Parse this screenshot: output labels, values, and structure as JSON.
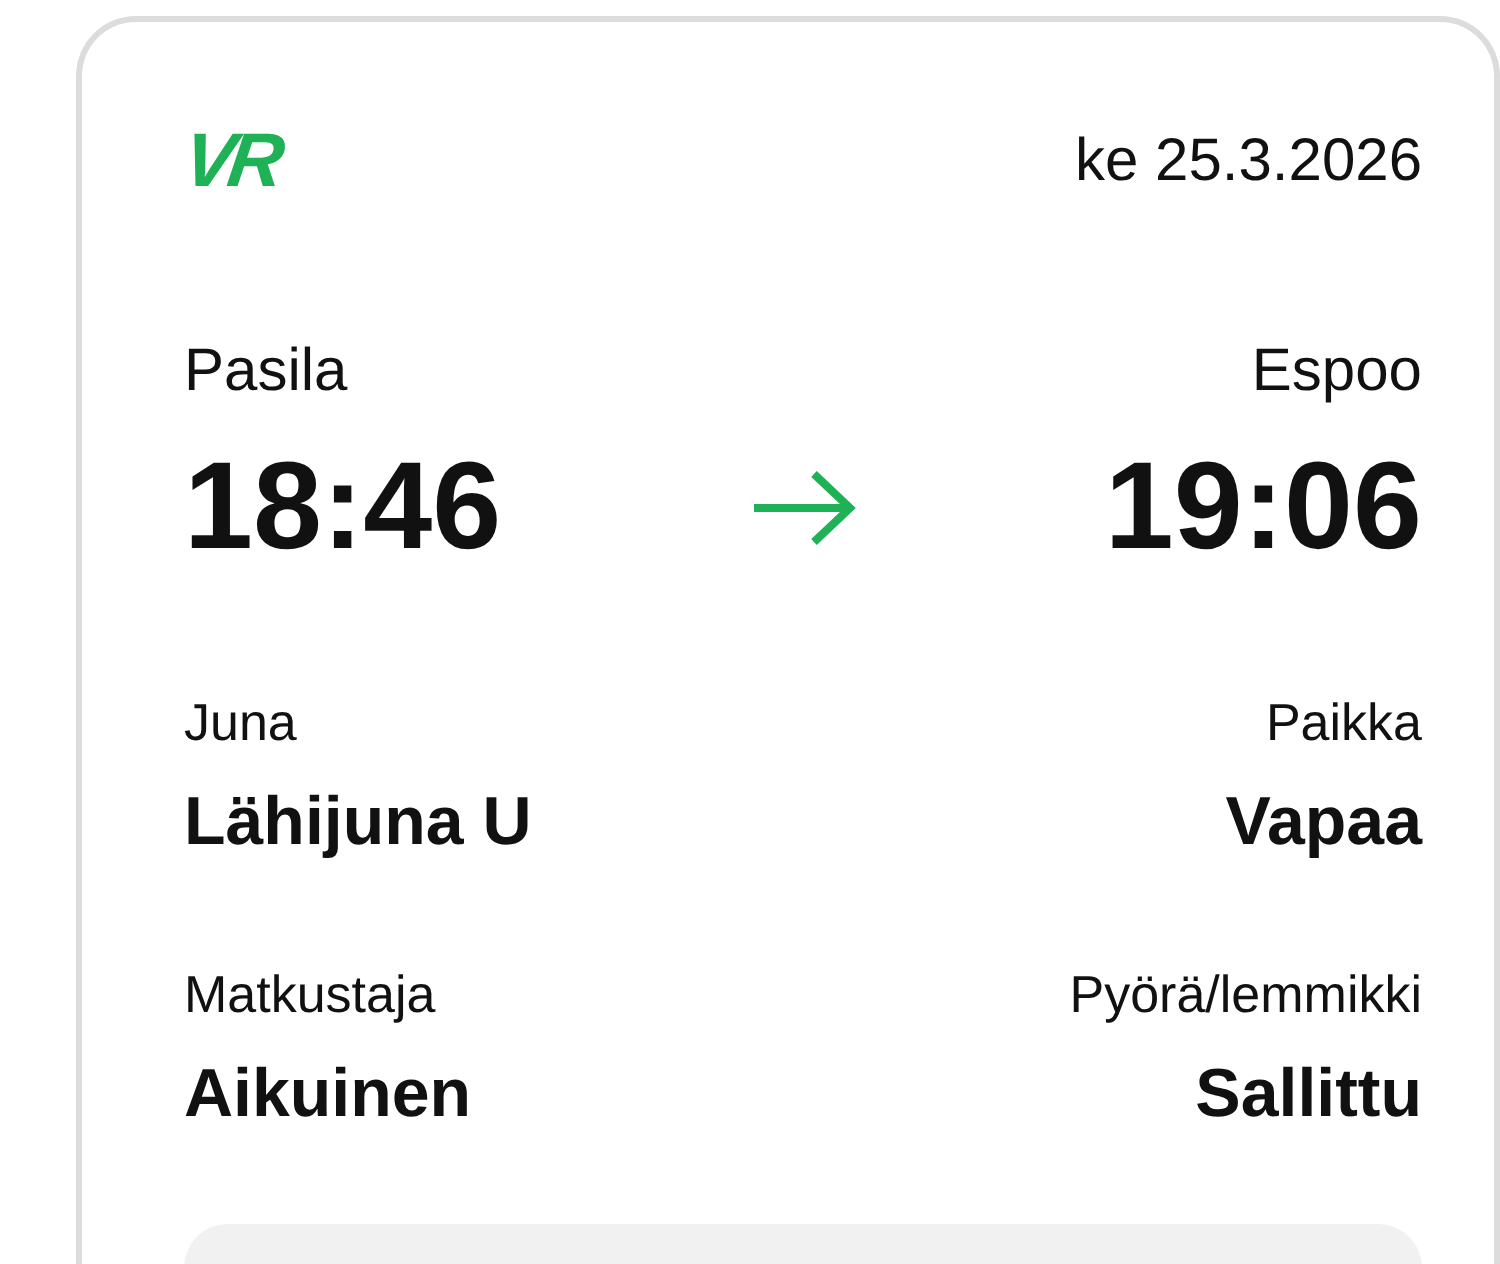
{
  "logo": "VR",
  "date": "ke 25.3.2026",
  "origin": {
    "station": "Pasila",
    "time": "18:46"
  },
  "destination": {
    "station": "Espoo",
    "time": "19:06"
  },
  "details": [
    {
      "label": "Juna",
      "value": "Lähijuna U"
    },
    {
      "label": "Paikka",
      "value": "Vapaa"
    },
    {
      "label": "Matkustaja",
      "value": "Aikuinen"
    },
    {
      "label": "Pyörä/lemmikki",
      "value": "Sallittu"
    }
  ]
}
